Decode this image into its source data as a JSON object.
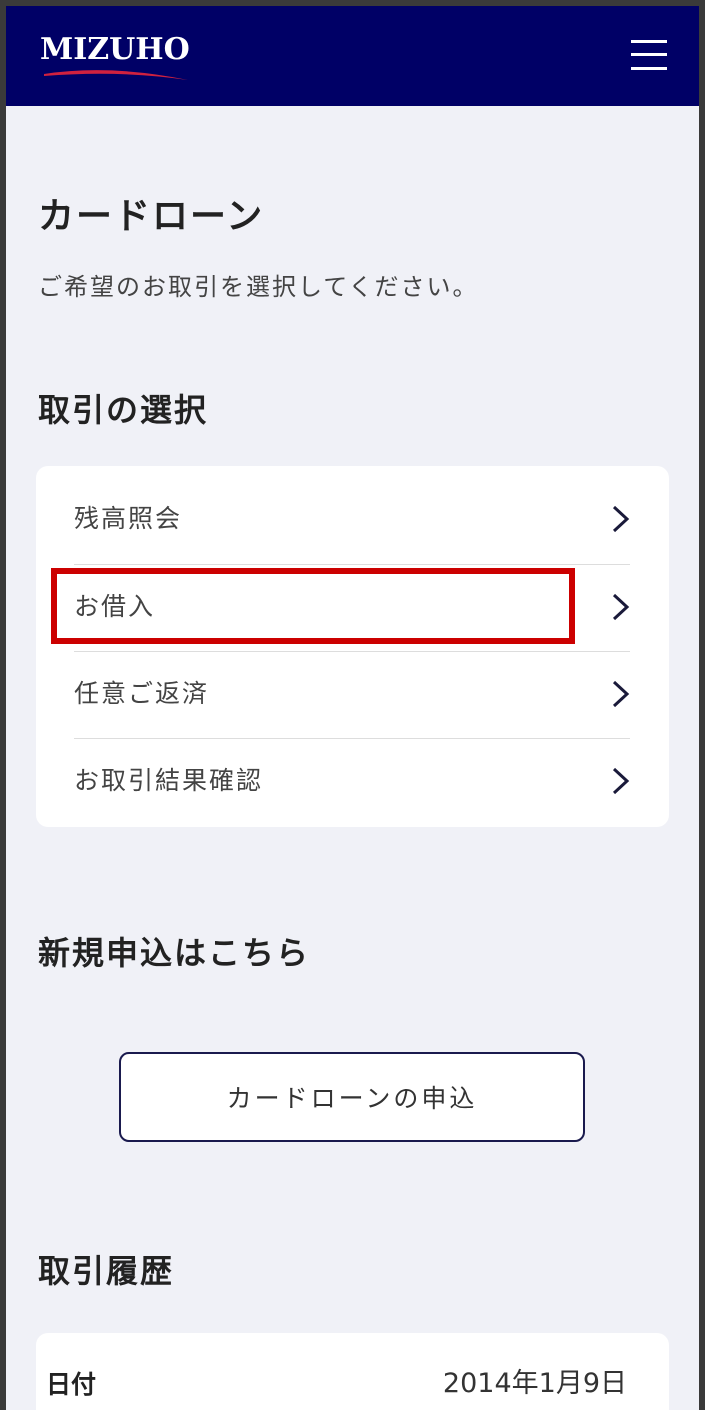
{
  "header": {
    "logo_text": "MIZUHO",
    "brand_color": "#000066",
    "accent_color": "#cc0000",
    "menu_icon": "hamburger-menu-icon"
  },
  "page": {
    "title": "カードローン",
    "subtitle": "ご希望のお取引を選択してください。"
  },
  "transaction_selection": {
    "heading": "取引の選択",
    "items": [
      {
        "label": "残高照会",
        "icon": "chevron-right-icon"
      },
      {
        "label": "お借入",
        "icon": "chevron-right-icon",
        "highlighted": true
      },
      {
        "label": "任意ご返済",
        "icon": "chevron-right-icon"
      },
      {
        "label": "お取引結果確認",
        "icon": "chevron-right-icon"
      }
    ]
  },
  "new_application": {
    "heading": "新規申込はこちら",
    "button_label": "カードローンの申込"
  },
  "transaction_history": {
    "heading": "取引履歴",
    "rows": [
      {
        "label": "日付",
        "value": "2014年1月9日"
      }
    ]
  }
}
